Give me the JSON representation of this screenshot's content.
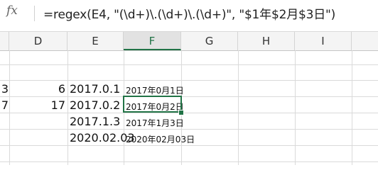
{
  "formula_bar": {
    "fx_label": "fx",
    "formula": "=regex(E4, \"(\\d+)\\.(\\d+)\\.(\\d+)\", \"$1年$2月$3日\")"
  },
  "columns": [
    {
      "key": "col-c",
      "label": ""
    },
    {
      "key": "col-d",
      "label": "D"
    },
    {
      "key": "col-e",
      "label": "E"
    },
    {
      "key": "col-f",
      "label": "F"
    },
    {
      "key": "col-g",
      "label": "G"
    },
    {
      "key": "col-h",
      "label": "H"
    },
    {
      "key": "col-i",
      "label": "I"
    }
  ],
  "rows": [
    {
      "c": "",
      "d": "",
      "e": "",
      "f": ""
    },
    {
      "c": "",
      "d": "",
      "e": "",
      "f": ""
    },
    {
      "c": "3",
      "d": "6",
      "e": "2017.0.1",
      "f": "2017年0月1日"
    },
    {
      "c": "7",
      "d": "17",
      "e": "2017.0.2",
      "f": "2017年0月2日"
    },
    {
      "c": "",
      "d": "",
      "e": "2017.1.3",
      "f": "2017年1月3日"
    },
    {
      "c": "",
      "d": "",
      "e": "2020.02.03",
      "f": "2020年02月03日"
    },
    {
      "c": "",
      "d": "",
      "e": "",
      "f": ""
    }
  ],
  "selected_cell": "F4",
  "accent_color": "#217346"
}
